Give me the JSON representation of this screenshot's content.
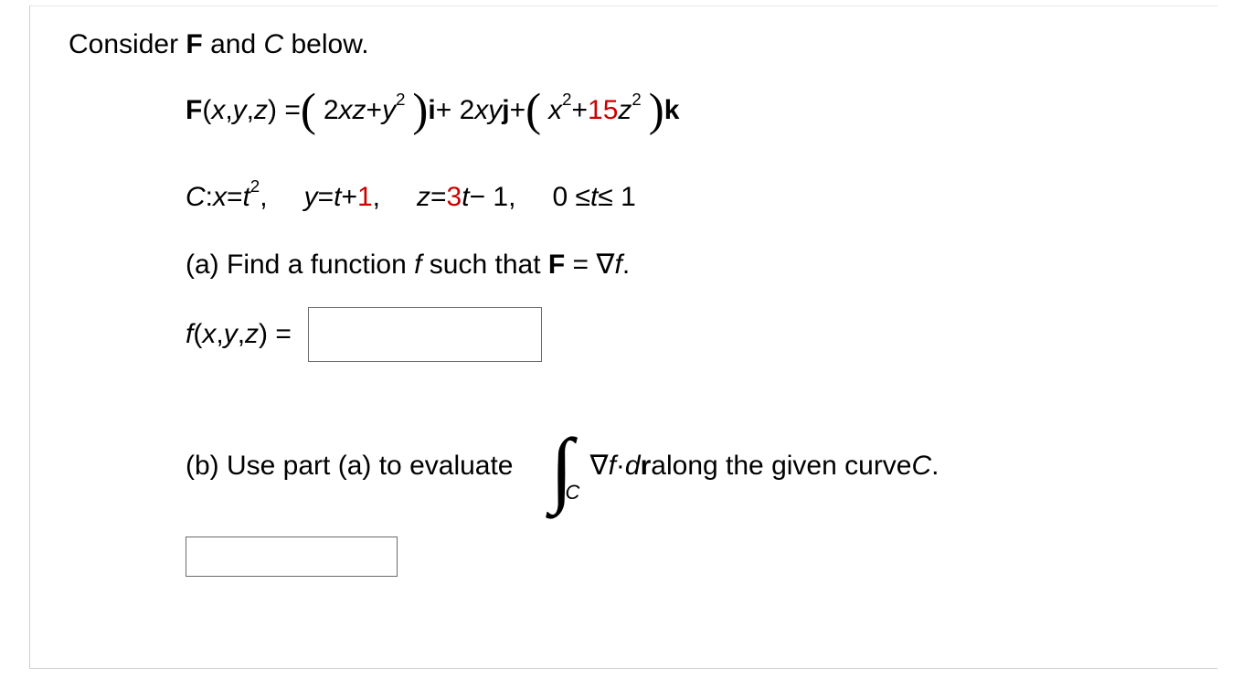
{
  "intro": {
    "prefix": "Consider ",
    "F": "F",
    "mid": " and ",
    "C": "C",
    "suffix": " below."
  },
  "formula": {
    "lhs_F": "F",
    "lhs_args_open": "(",
    "x": "x",
    "comma1": ", ",
    "y": "y",
    "comma2": ", ",
    "z": "z",
    "lhs_args_close": ") = ",
    "big_open1": "(",
    "t1a": "2",
    "t1b": "xz",
    "plus1": " + ",
    "t2a": "y",
    "t2b_sup": "2",
    "big_close1": ")",
    "sp1": " ",
    "i": "i",
    "plus2": " + 2",
    "t3": "xy",
    "sp2": " ",
    "j": "j",
    "plus3": " + ",
    "big_open2": "(",
    "t4a": "x",
    "t4b_sup": "2",
    "plus4": " + ",
    "t5_red": "15",
    "t5b": "z",
    "t5c_sup": "2",
    "big_close2": ")",
    "sp3": " ",
    "k": "k"
  },
  "curve": {
    "C": "C",
    "colon": ": ",
    "x": "x",
    "eq1": " = ",
    "t": "t",
    "sup2": "2",
    "comma": ",",
    "y_lbl": "y",
    "y_rhs": "t",
    "y_plus": " + ",
    "y_red": "1",
    "z_lbl": "z",
    "z_eq": " = ",
    "z_red": "3",
    "z_t": "t",
    "z_minus": " − 1,",
    "range": "0 ≤ ",
    "range_t": "t",
    "range_end": " ≤ 1"
  },
  "part_a": {
    "label": "(a) Find a function ",
    "f": "f",
    "mid": " such that ",
    "F": "F",
    "eq": " = ∇",
    "f2": "f",
    "dot": "."
  },
  "fxyz": {
    "f": "f",
    "open": "(",
    "x": "x",
    "c1": ", ",
    "y": "y",
    "c2": ", ",
    "z": "z",
    "close": ") ="
  },
  "part_b": {
    "label": "(b) Use part (a) to evaluate ",
    "grad": "∇",
    "f": "f",
    "dot": " · ",
    "d": "d",
    "r": "r",
    "along": "  along the given curve ",
    "C": "C",
    "end": ".",
    "int_sub": "C"
  }
}
